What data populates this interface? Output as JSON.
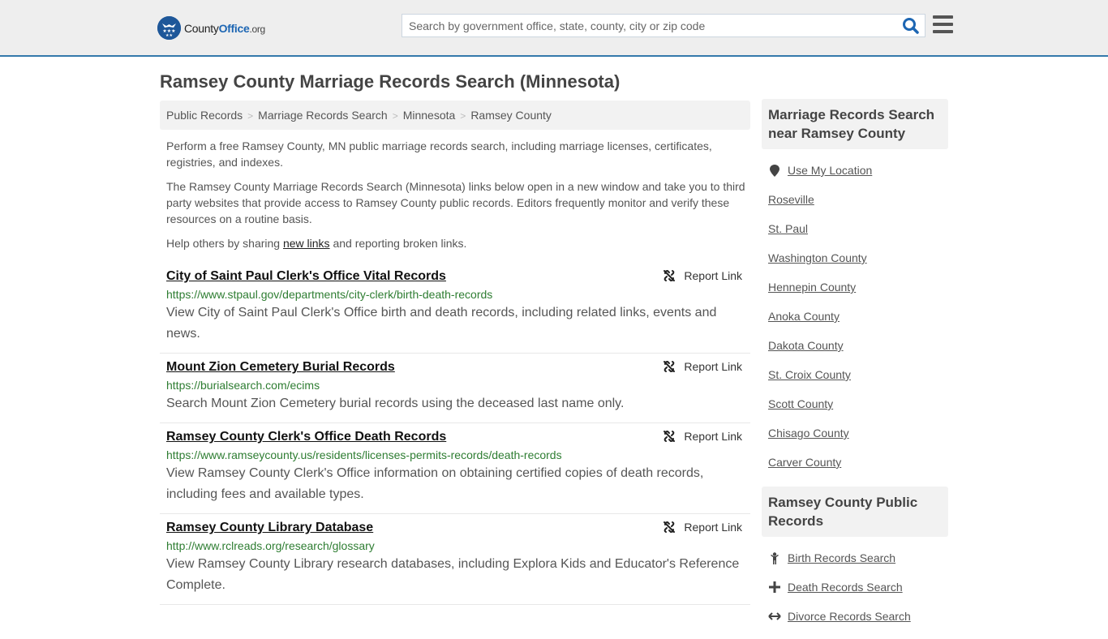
{
  "header": {
    "logo_county": "County",
    "logo_office": "Office",
    "logo_tld": ".org",
    "search_placeholder": "Search by government office, state, county, city or zip code",
    "search_value": ""
  },
  "page_title": "Ramsey County Marriage Records Search (Minnesota)",
  "breadcrumb": [
    "Public Records",
    "Marriage Records Search",
    "Minnesota",
    "Ramsey County"
  ],
  "intro": {
    "p1": "Perform a free Ramsey County, MN public marriage records search, including marriage licenses, certificates, registries, and indexes.",
    "p2": "The Ramsey County Marriage Records Search (Minnesota) links below open in a new window and take you to third party websites that provide access to Ramsey County public records. Editors frequently monitor and verify these resources on a routine basis.",
    "p3_before": "Help others by sharing ",
    "p3_link": "new links",
    "p3_after": " and reporting broken links."
  },
  "report_label": "Report Link",
  "results": [
    {
      "title": "City of Saint Paul Clerk's Office Vital Records",
      "url": "https://www.stpaul.gov/departments/city-clerk/birth-death-records",
      "description": "View City of Saint Paul Clerk's Office birth and death records, including related links, events and news."
    },
    {
      "title": "Mount Zion Cemetery Burial Records",
      "url": "https://burialsearch.com/ecims",
      "description": "Search Mount Zion Cemetery burial records using the deceased last name only."
    },
    {
      "title": "Ramsey County Clerk's Office Death Records",
      "url": "https://www.ramseycounty.us/residents/licenses-permits-records/death-records",
      "description": "View Ramsey County Clerk's Office information on obtaining certified copies of death records, including fees and available types."
    },
    {
      "title": "Ramsey County Library Database",
      "url": "http://www.rclreads.org/research/glossary",
      "description": "View Ramsey County Library research databases, including Explora Kids and Educator's Reference Complete."
    }
  ],
  "sidebar": {
    "nearby_heading": "Marriage Records Search near Ramsey County",
    "use_location": "Use My Location",
    "nearby": [
      "Roseville",
      "St. Paul",
      "Washington County",
      "Hennepin County",
      "Anoka County",
      "Dakota County",
      "St. Croix County",
      "Scott County",
      "Chisago County",
      "Carver County"
    ],
    "public_heading": "Ramsey County Public Records",
    "public_links": [
      {
        "label": "Birth Records Search",
        "icon": "child-icon"
      },
      {
        "label": "Death Records Search",
        "icon": "cross-icon"
      },
      {
        "label": "Divorce Records Search",
        "icon": "arrows-icon"
      }
    ]
  }
}
